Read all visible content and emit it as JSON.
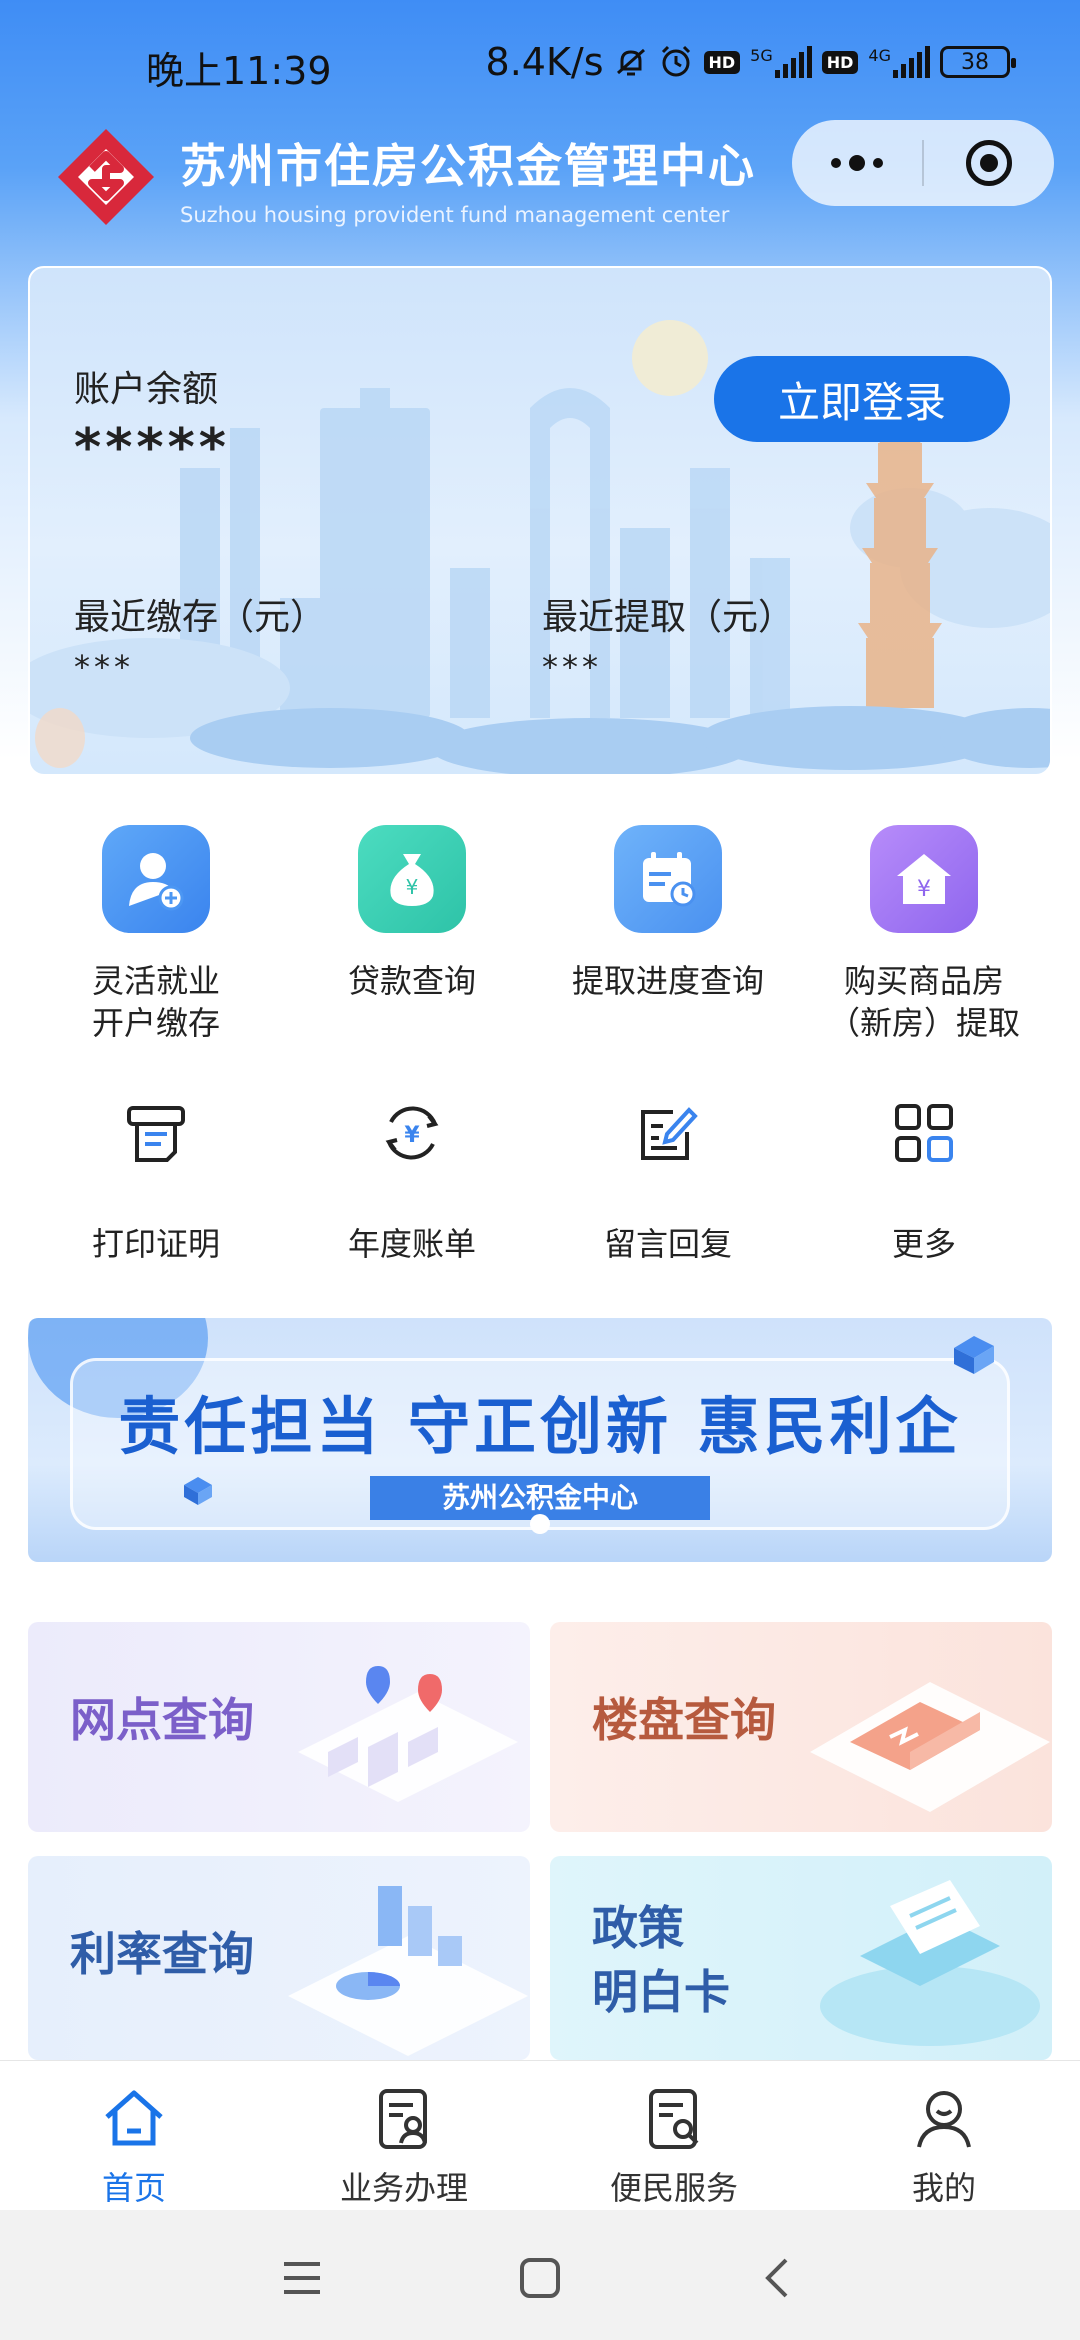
{
  "status_bar": {
    "time": "晚上11:39",
    "net_speed": "8.4K/s",
    "net_5g": "5G",
    "net_4g": "4G",
    "hd": "HD",
    "battery": "38"
  },
  "header": {
    "title": "苏州市住房公积金管理中心",
    "subtitle": "Suzhou housing provident fund management center"
  },
  "account": {
    "balance_label": "账户余额",
    "balance_value": "*****",
    "login_button": "立即登录",
    "recent_deposit_label": "最近缴存（元）",
    "recent_deposit_value": "***",
    "recent_withdraw_label": "最近提取（元）",
    "recent_withdraw_value": "***"
  },
  "quick_services": [
    {
      "label": "灵活就业\n开户缴存",
      "icon": "flexible-employment-icon"
    },
    {
      "label": "贷款查询",
      "icon": "loan-query-icon"
    },
    {
      "label": "提取进度查询",
      "icon": "withdraw-progress-icon"
    },
    {
      "label": "购买商品房\n（新房）提取",
      "icon": "house-purchase-icon"
    }
  ],
  "secondary_services": [
    {
      "label": "打印证明",
      "icon": "print-icon"
    },
    {
      "label": "年度账单",
      "icon": "annual-bill-icon"
    },
    {
      "label": "留言回复",
      "icon": "message-reply-icon"
    },
    {
      "label": "更多",
      "icon": "more-grid-icon"
    }
  ],
  "banner": {
    "title": "责任担当 守正创新 惠民利企",
    "subtitle": "苏州公积金中心"
  },
  "query_cards": [
    {
      "label": "网点查询",
      "color": "#7b5fc9"
    },
    {
      "label": "楼盘查询",
      "color": "#b65a3e"
    },
    {
      "label": "利率查询",
      "color": "#2f5da8"
    },
    {
      "label": "政策\n明白卡",
      "color": "#2f5da8"
    }
  ],
  "tabbar": [
    {
      "label": "首页",
      "icon": "home-icon",
      "active": true
    },
    {
      "label": "业务办理",
      "icon": "business-icon",
      "active": false
    },
    {
      "label": "便民服务",
      "icon": "service-icon",
      "active": false
    },
    {
      "label": "我的",
      "icon": "profile-icon",
      "active": false
    }
  ],
  "colors": {
    "primary": "#1a74e8",
    "header_blue": "#3f8df5"
  }
}
